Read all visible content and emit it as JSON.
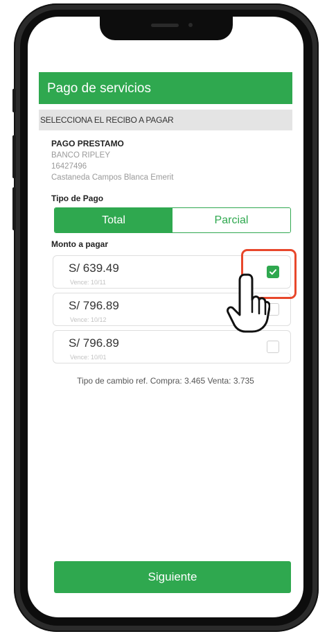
{
  "header": {
    "title": "Pago de servicios"
  },
  "section": {
    "label": "SELECCIONA EL RECIBO A PAGAR"
  },
  "receipt": {
    "title": "PAGO PRESTAMO",
    "bank": "BANCO RIPLEY",
    "code": "16427496",
    "holder": "Castaneda Campos Blanca Emerit"
  },
  "payment_type": {
    "label": "Tipo de Pago",
    "options": [
      "Total",
      "Parcial"
    ],
    "selected": "Total"
  },
  "amounts": {
    "label": "Monto a pagar",
    "items": [
      {
        "amount": "S/ 639.49",
        "due": "Vence: 10/11",
        "checked": true
      },
      {
        "amount": "S/ 796.89",
        "due": "Vence: 10/12",
        "checked": false
      },
      {
        "amount": "S/ 796.89",
        "due": "Vence: 10/01",
        "checked": false
      }
    ]
  },
  "exchange_rate": "Tipo de cambio ref. Compra: 3.465 Venta: 3.735",
  "next_button": {
    "label": "Siguiente"
  },
  "colors": {
    "primary": "#2fa84f",
    "highlight": "#e8472b",
    "section_bg": "#e4e4e4"
  },
  "icons": {
    "checkbox_checked": "check-icon",
    "pointer": "hand-pointer-icon"
  }
}
